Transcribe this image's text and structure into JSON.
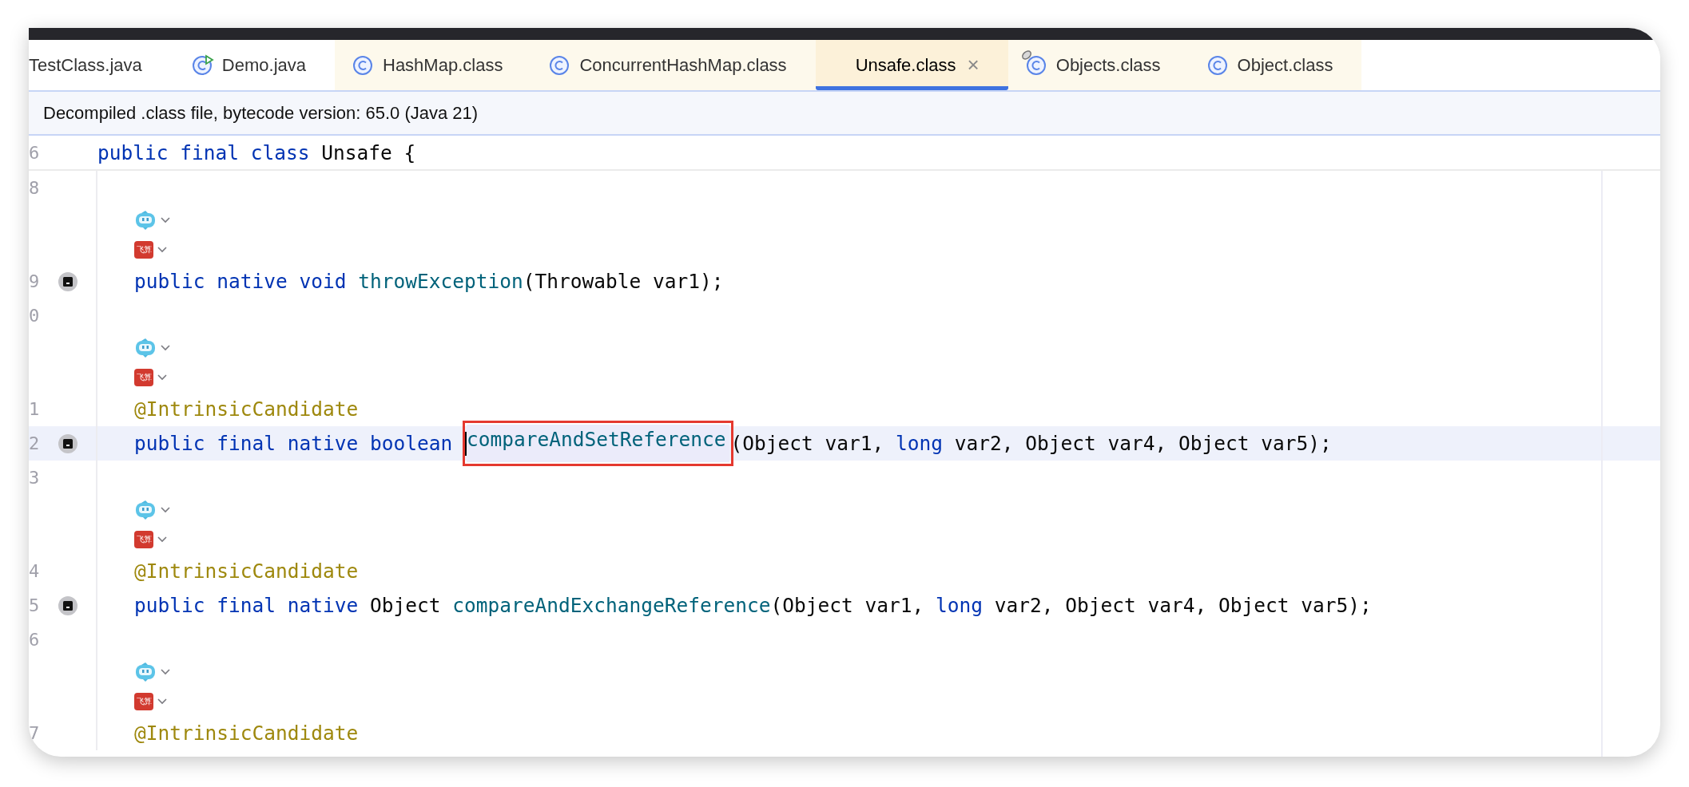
{
  "tabs": [
    {
      "label": "TestClass.java",
      "kind": "plain",
      "library": false,
      "selected": false,
      "pinned": false
    },
    {
      "label": "Demo.java",
      "kind": "runnable",
      "library": false,
      "selected": false,
      "pinned": false
    },
    {
      "label": "HashMap.class",
      "kind": "class",
      "library": true,
      "selected": false,
      "pinned": false
    },
    {
      "label": "ConcurrentHashMap.class",
      "kind": "class",
      "library": true,
      "selected": false,
      "pinned": false
    },
    {
      "label": "Unsafe.class",
      "kind": "plain",
      "library": true,
      "selected": true,
      "pinned": false,
      "close": "×"
    },
    {
      "label": "Objects.class",
      "kind": "class",
      "library": true,
      "selected": false,
      "pinned": true
    },
    {
      "label": "Object.class",
      "kind": "class",
      "library": true,
      "selected": false,
      "pinned": false
    }
  ],
  "info_bar": {
    "text": "Decompiled .class file, bytecode version: 65.0 (Java 21)"
  },
  "sticky_line": {
    "number": "6",
    "tokens": [
      {
        "text": "public final class ",
        "kind": "keyword"
      },
      {
        "text": "Unsafe {",
        "kind": "plain"
      }
    ]
  },
  "body": [
    {
      "kind": "blank",
      "number": "8"
    },
    {
      "kind": "robot_inlay"
    },
    {
      "kind": "badge_inlay",
      "label": "飞算"
    },
    {
      "kind": "code",
      "number": "9",
      "gutter_icon": true,
      "current": false,
      "tokens": [
        {
          "text": "public native void ",
          "kind": "keyword"
        },
        {
          "text": "throwException",
          "kind": "method"
        },
        {
          "text": "(Throwable var1);",
          "kind": "plain"
        }
      ]
    },
    {
      "kind": "blank",
      "number": "0"
    },
    {
      "kind": "robot_inlay"
    },
    {
      "kind": "badge_inlay",
      "label": "飞算"
    },
    {
      "kind": "code",
      "number": "1",
      "gutter_icon": false,
      "current": false,
      "tokens": [
        {
          "text": "@IntrinsicCandidate",
          "kind": "annotation"
        }
      ]
    },
    {
      "kind": "code",
      "number": "2",
      "gutter_icon": true,
      "current": true,
      "tokens": [
        {
          "text": "public final native boolean ",
          "kind": "keyword"
        },
        {
          "text": "compareAndSetReference",
          "kind": "method",
          "caret": true,
          "highlighted": true,
          "boxed": true
        },
        {
          "text": "(Object var1, ",
          "kind": "plain"
        },
        {
          "text": "long ",
          "kind": "keyword"
        },
        {
          "text": "var2, Object var4, Object var5);",
          "kind": "plain"
        }
      ]
    },
    {
      "kind": "blank",
      "number": "3"
    },
    {
      "kind": "robot_inlay"
    },
    {
      "kind": "badge_inlay",
      "label": "飞算"
    },
    {
      "kind": "code",
      "number": "4",
      "gutter_icon": false,
      "current": false,
      "tokens": [
        {
          "text": "@IntrinsicCandidate",
          "kind": "annotation"
        }
      ]
    },
    {
      "kind": "code",
      "number": "5",
      "gutter_icon": true,
      "current": false,
      "tokens": [
        {
          "text": "public final native ",
          "kind": "keyword"
        },
        {
          "text": "Object ",
          "kind": "plain"
        },
        {
          "text": "compareAndExchangeReference",
          "kind": "method"
        },
        {
          "text": "(Object var1, ",
          "kind": "plain"
        },
        {
          "text": "long ",
          "kind": "keyword"
        },
        {
          "text": "var2, Object var4, Object var5);",
          "kind": "plain"
        }
      ]
    },
    {
      "kind": "blank",
      "number": "6"
    },
    {
      "kind": "robot_inlay"
    },
    {
      "kind": "badge_inlay",
      "label": "飞算"
    },
    {
      "kind": "code",
      "number": "7",
      "gutter_icon": false,
      "current": false,
      "tokens": [
        {
          "text": "@IntrinsicCandidate",
          "kind": "annotation"
        }
      ]
    }
  ]
}
